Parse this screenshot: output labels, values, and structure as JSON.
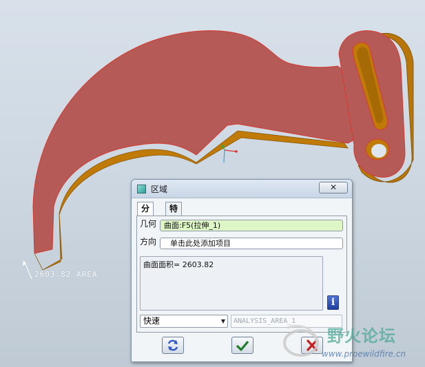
{
  "viewport": {
    "annotation": "2603.82 AREA",
    "part_face_color": "#b55a57",
    "part_side_color": "#c07a08"
  },
  "dialog": {
    "title": "区域",
    "close_label": "✕",
    "tabs": [
      {
        "label": "分析"
      },
      {
        "label": "特征"
      }
    ],
    "geometry_label": "几何",
    "geometry_value": "曲面:F5(拉伸_1)",
    "direction_label": "方向",
    "direction_value": "单击此处添加项目",
    "result_text": "曲面面积= 2603.82",
    "mode_selected": "快速",
    "analysis_name": "ANALYSIS_AREA_1",
    "info_icon": "i"
  },
  "watermark": {
    "title": "野火论坛",
    "url": "www.proewildfire.cn"
  }
}
